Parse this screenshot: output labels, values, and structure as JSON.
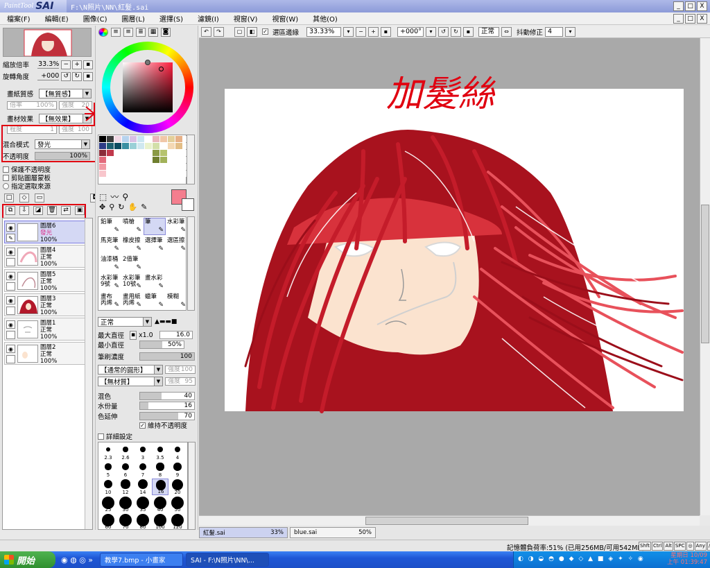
{
  "window": {
    "app_name_small": "PaintTool",
    "app_name": "SAI",
    "title_path": "F:\\N照片\\NN\\紅髮.sai",
    "buttons": [
      "_",
      "□",
      "X"
    ],
    "inner_buttons": [
      "_",
      "□",
      "X"
    ]
  },
  "menu": [
    "檔案(F)",
    "編輯(E)",
    "圖像(C)",
    "圖層(L)",
    "選擇(S)",
    "濾鏡(I)",
    "視窗(V)",
    "視窗(W)",
    "其他(O)"
  ],
  "navigator": {
    "zoom_label": "縮放倍率",
    "zoom_value": "33.3%",
    "angle_label": "旋轉角度",
    "angle_value": "+000"
  },
  "paper": {
    "texture_label": "畫紙質感",
    "texture_value": "【無質感】",
    "scale_label": "倍率",
    "scale_value": "100%",
    "strength_label": "強度",
    "strength_value": "20",
    "effect_label": "畫材效果",
    "effect_value": "【無效果】",
    "degree_label": "程度",
    "degree_value": "1",
    "effect_strength_label": "強度",
    "effect_strength_value": "100"
  },
  "blend": {
    "mode_label": "混合模式",
    "mode_value": "發光",
    "opacity_label": "不透明度",
    "opacity_value": "100%",
    "opacity_fraction": 1.0
  },
  "layer_options": {
    "preserve": "保護不透明度",
    "clip": "剪貼圖層蒙板",
    "selection_source": "指定選取來源"
  },
  "layers": [
    {
      "name": "圖層6",
      "mode": "發光",
      "opacity": "100%",
      "selected": true,
      "thumb": "blank"
    },
    {
      "name": "圖層4",
      "mode": "正常",
      "opacity": "100%",
      "selected": false,
      "thumb": "pink"
    },
    {
      "name": "圖層5",
      "mode": "正常",
      "opacity": "100%",
      "selected": false,
      "thumb": "sketch"
    },
    {
      "name": "圖層3",
      "mode": "正常",
      "opacity": "100%",
      "selected": false,
      "thumb": "hair"
    },
    {
      "name": "圖層1",
      "mode": "正常",
      "opacity": "100%",
      "selected": false,
      "thumb": "lines"
    },
    {
      "name": "圖層2",
      "mode": "正常",
      "opacity": "100%",
      "selected": false,
      "thumb": "skin"
    }
  ],
  "colors": {
    "primary": "#f47e8e",
    "secondary": "#ffffff",
    "accent": "#cc1f2f",
    "highlight_red": "#e00010",
    "selected_bg": "#d4d8f4"
  },
  "swatches": [
    "#000000",
    "#3a3a3a",
    "#f1d8e4",
    "#b7d3ee",
    "#d8c0e4",
    "#c9e6f1",
    "#ffffff",
    "#e9b6bc",
    "#f0c7a8",
    "#e3cf9a",
    "#e6b087",
    "#ffffff",
    "#2d3b86",
    "#1c5f70",
    "#0c4b60",
    "#3a90a3",
    "#9ad0d7",
    "#cfe8f0",
    "#e9f2cd",
    "#d2dfa8",
    "#ffffff",
    "#f4d8b4",
    "#e2bd86",
    "#ffffff",
    "#8b2d3a",
    "#c0394c",
    "#ffffff",
    "#ffffff",
    "#ffffff",
    "#ffffff",
    "#ffffff",
    "#8a9a45",
    "#b6c36e",
    "#ffffff",
    "#ffffff",
    "#ffffff",
    "#e36a7b",
    "#ffffff",
    "#ffffff",
    "#ffffff",
    "#ffffff",
    "#ffffff",
    "#ffffff",
    "#6f7f2f",
    "#a2b259",
    "#ffffff",
    "#ffffff",
    "#ffffff",
    "#f29aa4",
    "#ffffff",
    "#ffffff",
    "#ffffff",
    "#ffffff",
    "#ffffff",
    "#ffffff",
    "#ffffff",
    "#ffffff",
    "#ffffff",
    "#ffffff",
    "#ffffff",
    "#f8c6cc",
    "#ffffff",
    "#ffffff",
    "#ffffff",
    "#ffffff",
    "#ffffff",
    "#ffffff",
    "#ffffff",
    "#ffffff",
    "#ffffff",
    "#ffffff",
    "#ffffff"
  ],
  "tools": [
    {
      "label": "鉛筆",
      "sel": false
    },
    {
      "label": "噴槍",
      "sel": false
    },
    {
      "label": "筆",
      "sel": true
    },
    {
      "label": "水彩筆",
      "sel": false
    },
    {
      "label": "馬克筆",
      "sel": false
    },
    {
      "label": "橡皮擦",
      "sel": false
    },
    {
      "label": "選擇筆",
      "sel": false
    },
    {
      "label": "選區擦",
      "sel": false
    },
    {
      "label": "油漆桶",
      "sel": false
    },
    {
      "label": "2值筆",
      "sel": false
    },
    {
      "label": "",
      "sel": false
    },
    {
      "label": "",
      "sel": false
    },
    {
      "label": "水彩筆\n9號",
      "sel": false
    },
    {
      "label": "水彩筆\n10號",
      "sel": false
    },
    {
      "label": "畫水彩",
      "sel": false
    },
    {
      "label": "",
      "sel": false
    },
    {
      "label": "畫布\n丙烯",
      "sel": false
    },
    {
      "label": "畫用紙\n丙烯",
      "sel": false
    },
    {
      "label": "蠟筆",
      "sel": false
    },
    {
      "label": "模糊",
      "sel": false
    }
  ],
  "brush": {
    "mode": "正常",
    "max_size_label": "最大直徑",
    "max_mult": "x1.0",
    "max_size": "16.0",
    "min_size_label": "最小直徑",
    "min_size": "50%",
    "min_fraction": 0.5,
    "density_label": "筆刷濃度",
    "density": "100",
    "density_fraction": 1.0,
    "shape_value": "【通常的圓形】",
    "shape_strength_label": "強度",
    "shape_strength": "100",
    "texture_value": "【無材質】",
    "texture_strength_label": "強度",
    "texture_strength": "95",
    "blend_label": "混色",
    "blend": "40",
    "blend_fraction": 0.4,
    "water_label": "水份量",
    "water": "16",
    "water_fraction": 0.16,
    "persist_label": "色延伸",
    "persist": "70",
    "persist_fraction": 0.7,
    "keep_opacity": "維持不透明度",
    "advanced": "詳細設定"
  },
  "brush_sizes": [
    "2.3",
    "2.6",
    "3",
    "3.5",
    "4",
    "5",
    "6",
    "7",
    "8",
    "9",
    "10",
    "12",
    "14",
    "16",
    "20",
    "25",
    "30",
    "35",
    "40",
    "50",
    "60",
    "70",
    "80",
    "100",
    "120"
  ],
  "selected_brush_size": "16",
  "canvas_toolbar": {
    "selection_edge": "選區邊緣",
    "zoom": "33.33%",
    "angle": "+000°",
    "mode": "正常",
    "stabilizer_label": "抖動修正",
    "stabilizer": "4"
  },
  "canvas_annotation": "加髮絲",
  "docs": [
    {
      "name": "紅髮.sai",
      "zoom": "33%",
      "selected": true
    },
    {
      "name": "blue.sai",
      "zoom": "50%",
      "selected": false
    }
  ],
  "status": {
    "memory": "記憶體負荷率:51% (已用256MB/可用542MB)",
    "keys": [
      "Shft",
      "Ctrl",
      "Alt",
      "SPC",
      "◎",
      "Any",
      "∕"
    ]
  },
  "taskbar": {
    "start": "開始",
    "tasks": [
      "教學7.bmp - 小畫家",
      "SAI - F:\\N照片\\NN\\..."
    ],
    "clock_day": "星期日 10/09",
    "clock_time": "上午 01:39:47"
  }
}
